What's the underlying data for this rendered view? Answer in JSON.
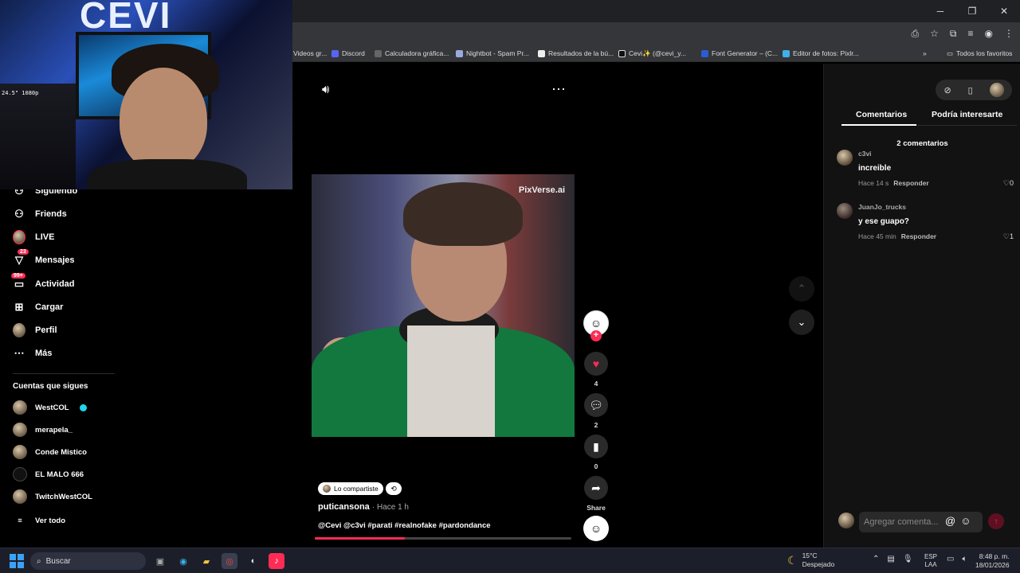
{
  "bookmarks": [
    "Videos gr...",
    "Discord",
    "Calculadora gráfica...",
    "Nightbot - Spam Pr...",
    "Resultados de la bú...",
    "Cevi✨ (@cevi_y...",
    "Font Generator – (C...",
    "Editor de fotos: Pixlr...",
    "Todos los favoritos"
  ],
  "webcam": {
    "logo": "CEVI",
    "monitor_text": "24.5\" 1080p"
  },
  "sidebar": {
    "items": [
      {
        "label": "Siguiendo",
        "icon": "following-icon"
      },
      {
        "label": "Friends",
        "icon": "friends-icon"
      },
      {
        "label": "LIVE",
        "icon": "live-avatar"
      },
      {
        "label": "Mensajes",
        "icon": "messages-icon",
        "badge": "23"
      },
      {
        "label": "Actividad",
        "icon": "activity-icon",
        "badge": "99+"
      },
      {
        "label": "Cargar",
        "icon": "upload-icon"
      },
      {
        "label": "Perfil",
        "icon": "profile-avatar"
      },
      {
        "label": "Más",
        "icon": "more-icon"
      }
    ],
    "following_title": "Cuentas que sigues",
    "following": [
      {
        "name": "WestCOL",
        "verified": true
      },
      {
        "name": "merapela_"
      },
      {
        "name": "Conde Mistico"
      },
      {
        "name": "EL MALO 666"
      },
      {
        "name": "TwitchWestCOL"
      }
    ],
    "see_all": "Ver todo"
  },
  "video": {
    "watermark": "PixVerse.ai",
    "shared_label": "Lo compartiste",
    "author": "puticansona",
    "time": "· Hace 1 h",
    "caption": "@Cevi @c3vi #parati  #realnofake #pardondance",
    "progress": 0.35,
    "likes": "4",
    "comments": "2",
    "saves": "0",
    "share_label": "Share"
  },
  "comments_panel": {
    "tabs": [
      "Comentarios",
      "Podría interesarte"
    ],
    "count_label": "2 comentarios",
    "comments": [
      {
        "user": "c3vi",
        "text": "increible",
        "time": "Hace 14 s",
        "reply": "Responder",
        "likes": "0"
      },
      {
        "user": "JuanJo_trucks",
        "text": "y ese guapo?",
        "time": "Hace 45 min",
        "reply": "Responder",
        "likes": "1"
      }
    ],
    "input_placeholder": "Agregar comenta..."
  },
  "taskbar": {
    "search_placeholder": "Buscar",
    "temp": "15°C",
    "weather": "Despejado",
    "lang1": "ESP",
    "lang2": "LAA",
    "time": "8:48 p. m.",
    "date": "18/01/2026"
  },
  "colors": {
    "accent": "#fe2c55",
    "panel": "#121212",
    "taskbar": "#1c1f2a"
  }
}
